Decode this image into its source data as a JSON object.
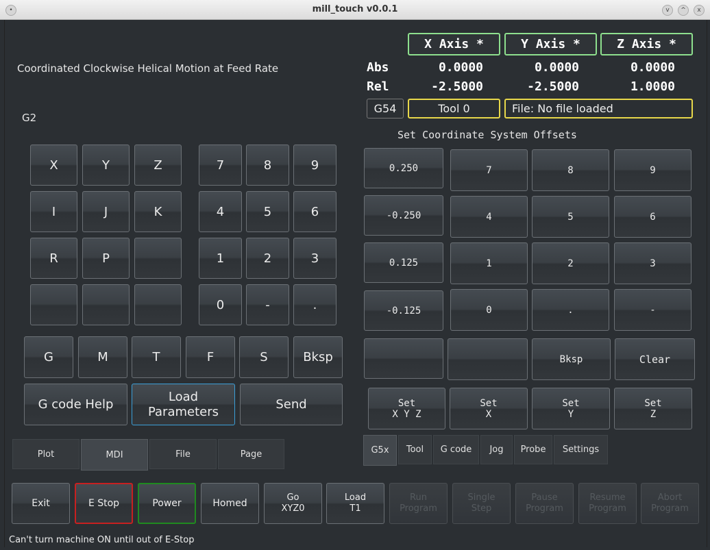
{
  "window": {
    "title": "mill_touch v0.0.1",
    "icon_menu": "•",
    "icon_min": "v",
    "icon_max": "^",
    "icon_close": "x"
  },
  "mdi": {
    "description": "Coordinated Clockwise Helical Motion at Feed Rate",
    "command": "G2",
    "letters": [
      "X",
      "Y",
      "Z",
      "I",
      "J",
      "K",
      "R",
      "P",
      "",
      "",
      "",
      ""
    ],
    "numpad": [
      "7",
      "8",
      "9",
      "4",
      "5",
      "6",
      "1",
      "2",
      "3",
      "0",
      "-",
      "."
    ],
    "words": [
      "G",
      "M",
      "T",
      "F",
      "S",
      "Bksp"
    ],
    "help": "G code Help",
    "load_params": [
      "Load",
      "Parameters"
    ],
    "send": "Send"
  },
  "dro": {
    "axes": [
      "X Axis *",
      "Y Axis *",
      "Z Axis *"
    ],
    "abs_label": "Abs",
    "rel_label": "Rel",
    "abs": [
      "0.0000",
      "0.0000",
      "0.0000"
    ],
    "rel": [
      "-2.5000",
      "-2.5000",
      "1.0000"
    ],
    "wcs": "G54",
    "tool": "Tool 0",
    "file": "File: No file loaded",
    "axis_color": "#8ee08e",
    "info_color": "#e8d84a"
  },
  "offsets": {
    "title": "Set Coordinate System Offsets",
    "presets": [
      "0.250",
      "-0.250",
      "0.125",
      "-0.125",
      ""
    ],
    "keys": [
      "7",
      "8",
      "9",
      "4",
      "5",
      "6",
      "1",
      "2",
      "3",
      "0",
      ".",
      "-",
      "",
      "Bksp",
      "Clear"
    ],
    "set": [
      [
        "Set",
        "X Y Z"
      ],
      [
        "Set",
        "X"
      ],
      [
        "Set",
        "Y"
      ],
      [
        "Set",
        "Z"
      ]
    ]
  },
  "right_tabs": [
    "G5x",
    "Tool",
    "G code",
    "Jog",
    "Probe",
    "Settings"
  ],
  "left_tabs": [
    "Plot",
    "MDI",
    "File",
    "Page"
  ],
  "bottom": {
    "exit": "Exit",
    "estop": "E Stop",
    "power": "Power",
    "homed": "Homed",
    "go": [
      "Go",
      "XYZ0"
    ],
    "load": [
      "Load",
      "T1"
    ],
    "run": [
      "Run",
      "Program"
    ],
    "single": [
      "Single",
      "Step"
    ],
    "pause": [
      "Pause",
      "Program"
    ],
    "resume": [
      "Resume",
      "Program"
    ],
    "abort": [
      "Abort",
      "Program"
    ]
  },
  "status": "Can't turn machine ON until out of E-Stop"
}
